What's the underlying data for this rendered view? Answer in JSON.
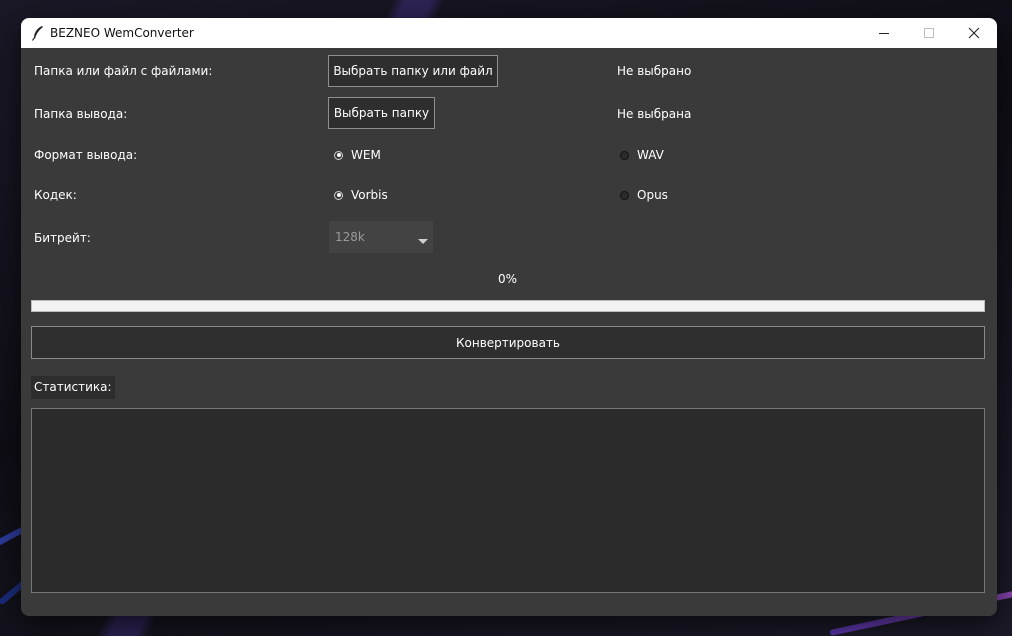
{
  "window": {
    "title": "BEZNEO WemConverter",
    "controls": [
      "minimize",
      "maximize",
      "close"
    ]
  },
  "form": {
    "source": {
      "label": "Папка или файл с файлами:",
      "button": "Выбрать папку или файл",
      "status": "Не выбрано"
    },
    "output": {
      "label": "Папка вывода:",
      "button": "Выбрать папку",
      "status": "Не выбрана"
    },
    "format": {
      "label": "Формат вывода:",
      "options": [
        {
          "label": "WEM",
          "selected": true
        },
        {
          "label": "WAV",
          "selected": false
        }
      ]
    },
    "codec": {
      "label": "Кодек:",
      "options": [
        {
          "label": "Vorbis",
          "selected": true
        },
        {
          "label": "Opus",
          "selected": false
        }
      ]
    },
    "bitrate": {
      "label": "Битрейт:",
      "value": "128k",
      "disabled": true
    }
  },
  "progress": {
    "text": "0%",
    "value": 0
  },
  "convert_button": "Конвертировать",
  "stats": {
    "label": "Статистика:",
    "content": ""
  },
  "colors": {
    "window_bg": "#3a3a3a",
    "titlebar_bg": "#ffffff",
    "text": "#ffffff",
    "button_bg": "#2e2e2e",
    "stats_bg": "#2b2b2b",
    "progress_track": "#f2f2f2"
  }
}
